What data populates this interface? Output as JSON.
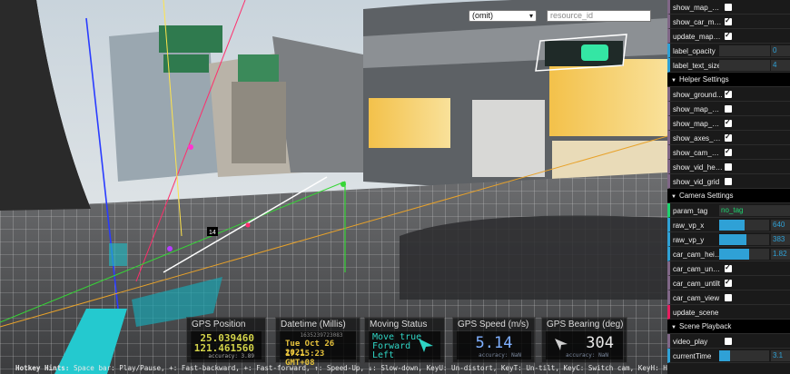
{
  "toolbar": {
    "dropdown_value": "(omit)",
    "resource_placeholder": "resource_id"
  },
  "scene": {
    "marker_label": "14"
  },
  "hud": {
    "gps_position": {
      "title": "GPS Position",
      "lat": "25.039460",
      "lon": "121.461560",
      "accuracy": "accuracy:  3.89"
    },
    "datetime": {
      "title": "Datetime (Millis)",
      "millis": "1635239723083",
      "date": "Tue Oct 26 2021",
      "time": "17:15:23 GMT+08"
    },
    "moving_status": {
      "title": "Moving Status",
      "line1": "Move true",
      "line2": "Forward",
      "line3": "Left"
    },
    "gps_speed": {
      "title": "GPS Speed (m/s)",
      "value": "5.14",
      "accuracy": "accuracy:  NaN"
    },
    "gps_bearing": {
      "title": "GPS Bearing (deg)",
      "value": "304",
      "accuracy": "accuracy:  NaN"
    }
  },
  "hotkeys": {
    "label": "Hotkey Hints:",
    "text": " Space bar: Play/Pause, +: Fast-backward, +: Fast-forward, ↑: Speed-Up, ↓: Slow-down, KeyU: Un-distort, KeyT: Un-tilt, KeyC: Switch cam, KeyH: Hide contorls."
  },
  "gui": {
    "top_rows": [
      {
        "label": "show_map_pl...",
        "type": "bool",
        "checked": false
      },
      {
        "label": "show_car_model",
        "type": "bool",
        "checked": true
      },
      {
        "label": "update_mapbox",
        "type": "bool",
        "checked": true
      },
      {
        "label": "label_opacity",
        "type": "num",
        "value": "0"
      },
      {
        "label": "label_text_size",
        "type": "num",
        "value": "4"
      }
    ],
    "helper": {
      "title": "Helper Settings",
      "rows": [
        {
          "label": "show_ground...",
          "type": "bool",
          "checked": true
        },
        {
          "label": "show_map_ax...",
          "type": "bool",
          "checked": false
        },
        {
          "label": "show_map_m...",
          "type": "bool",
          "checked": true
        },
        {
          "label": "show_axes_h...",
          "type": "bool",
          "checked": true
        },
        {
          "label": "show_cam_he...",
          "type": "bool",
          "checked": true
        },
        {
          "label": "show_vid_hel...",
          "type": "bool",
          "checked": false
        },
        {
          "label": "show_vid_grid",
          "type": "bool",
          "checked": false
        }
      ]
    },
    "camera": {
      "title": "Camera Settings",
      "rows": [
        {
          "label": "param_tag",
          "type": "str",
          "value": "no_tag"
        },
        {
          "label": "raw_vp_x",
          "type": "slider",
          "value": "640",
          "fill": 0.5
        },
        {
          "label": "raw_vp_y",
          "type": "slider",
          "value": "383",
          "fill": 0.55
        },
        {
          "label": "car_cam_height",
          "type": "slider",
          "value": "1.82",
          "fill": 0.6
        },
        {
          "label": "car_cam_undist",
          "type": "bool",
          "checked": true
        },
        {
          "label": "car_cam_untilt",
          "type": "bool",
          "checked": true
        },
        {
          "label": "car_cam_view",
          "type": "bool",
          "checked": false
        },
        {
          "label": "update_scene",
          "type": "fn"
        }
      ]
    },
    "playback": {
      "title": "Scene Playback",
      "rows": [
        {
          "label": "video_play",
          "type": "bool",
          "checked": false
        },
        {
          "label": "currentTime",
          "type": "slider",
          "value": "3.1",
          "fill": 0.22
        }
      ]
    }
  }
}
